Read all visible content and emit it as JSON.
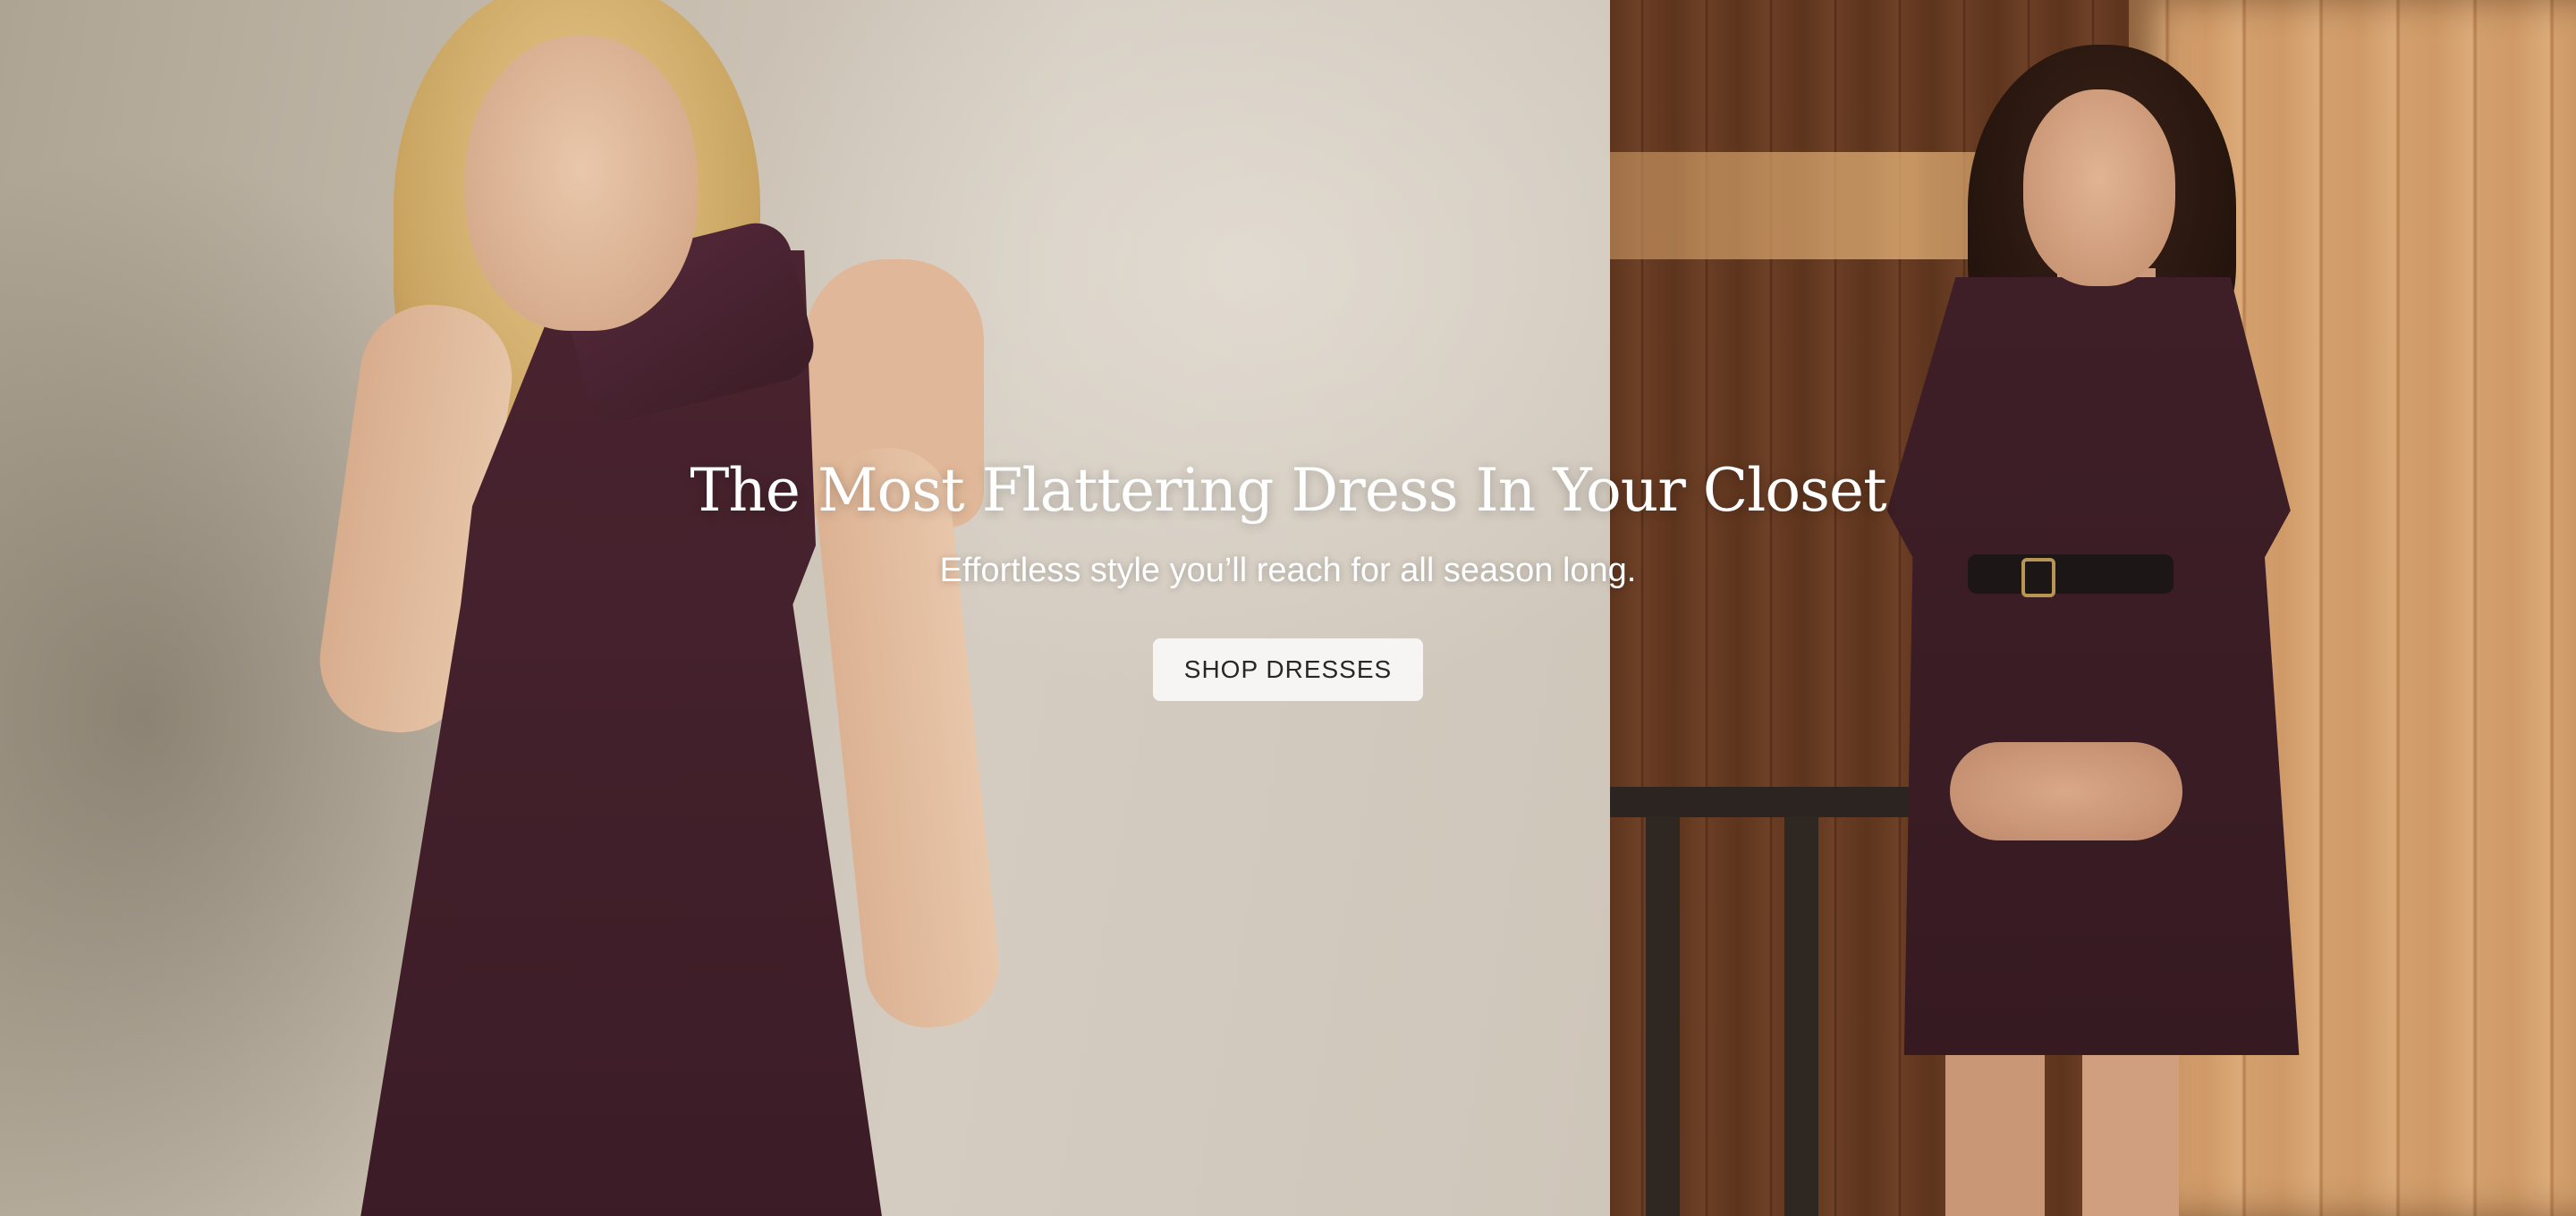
{
  "hero": {
    "headline": "The Most Flattering Dress In Your Closet",
    "subheadline": "Effortless style you’ll reach for all season long.",
    "cta_label": "SHOP DRESSES"
  },
  "colors": {
    "text": "#ffffff",
    "button_bg": "#f6f5f3",
    "button_text": "#2a2624",
    "dress": "#42202b"
  },
  "images": [
    {
      "name": "model-left-photo",
      "description_icon": "photo"
    },
    {
      "name": "model-right-photo",
      "description_icon": "photo"
    }
  ]
}
